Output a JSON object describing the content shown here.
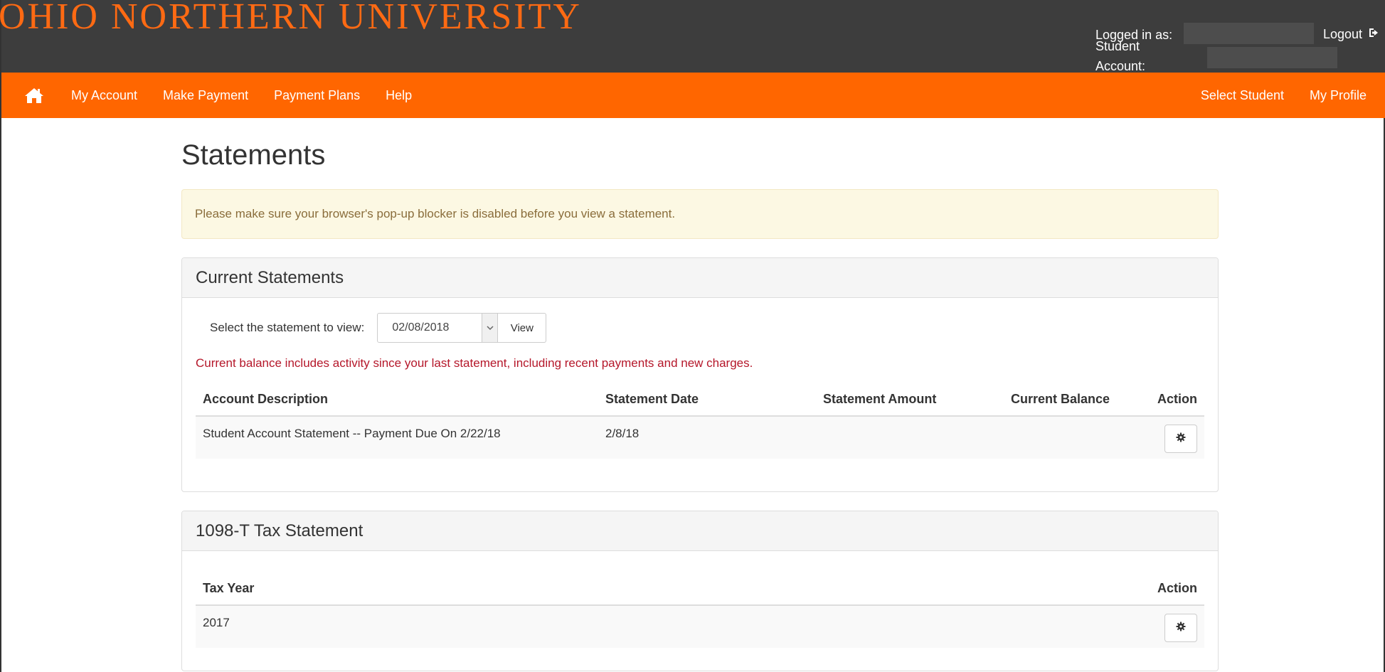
{
  "header": {
    "brand": "OHIO NORTHERN UNIVERSITY",
    "logged_in_label": "Logged in as:",
    "student_account_label": "Student Account:",
    "logout_label": "Logout"
  },
  "nav": {
    "left": [
      "My Account",
      "Make Payment",
      "Payment Plans",
      "Help"
    ],
    "right": [
      "Select Student",
      "My Profile"
    ]
  },
  "page": {
    "title": "Statements",
    "alert": "Please make sure your browser's pop-up blocker is disabled before you view a statement."
  },
  "current_statements": {
    "heading": "Current Statements",
    "select_label": "Select the statement to view:",
    "selected_date": "02/08/2018",
    "view_label": "View",
    "balance_note": "Current balance includes activity since your last statement, including recent payments and new charges.",
    "columns": [
      "Account Description",
      "Statement Date",
      "Statement Amount",
      "Current Balance",
      "Action"
    ],
    "rows": [
      {
        "description": "Student Account Statement -- Payment Due On 2/22/18",
        "date": "2/8/18",
        "amount": "",
        "balance": ""
      }
    ]
  },
  "tax_statement": {
    "heading": "1098-T Tax Statement",
    "columns": [
      "Tax Year",
      "Action"
    ],
    "rows": [
      {
        "year": "2017"
      }
    ]
  },
  "colors": {
    "header_bg": "#3d3d3d",
    "brand": "#ff6a13",
    "nav_bg": "#ff6600",
    "alert_bg": "#fcf8e3",
    "alert_text": "#8a6d3b",
    "note_text": "#b5172a"
  },
  "icons": [
    "home-icon",
    "logout-icon",
    "chevron-down-icon",
    "gear-icon"
  ]
}
